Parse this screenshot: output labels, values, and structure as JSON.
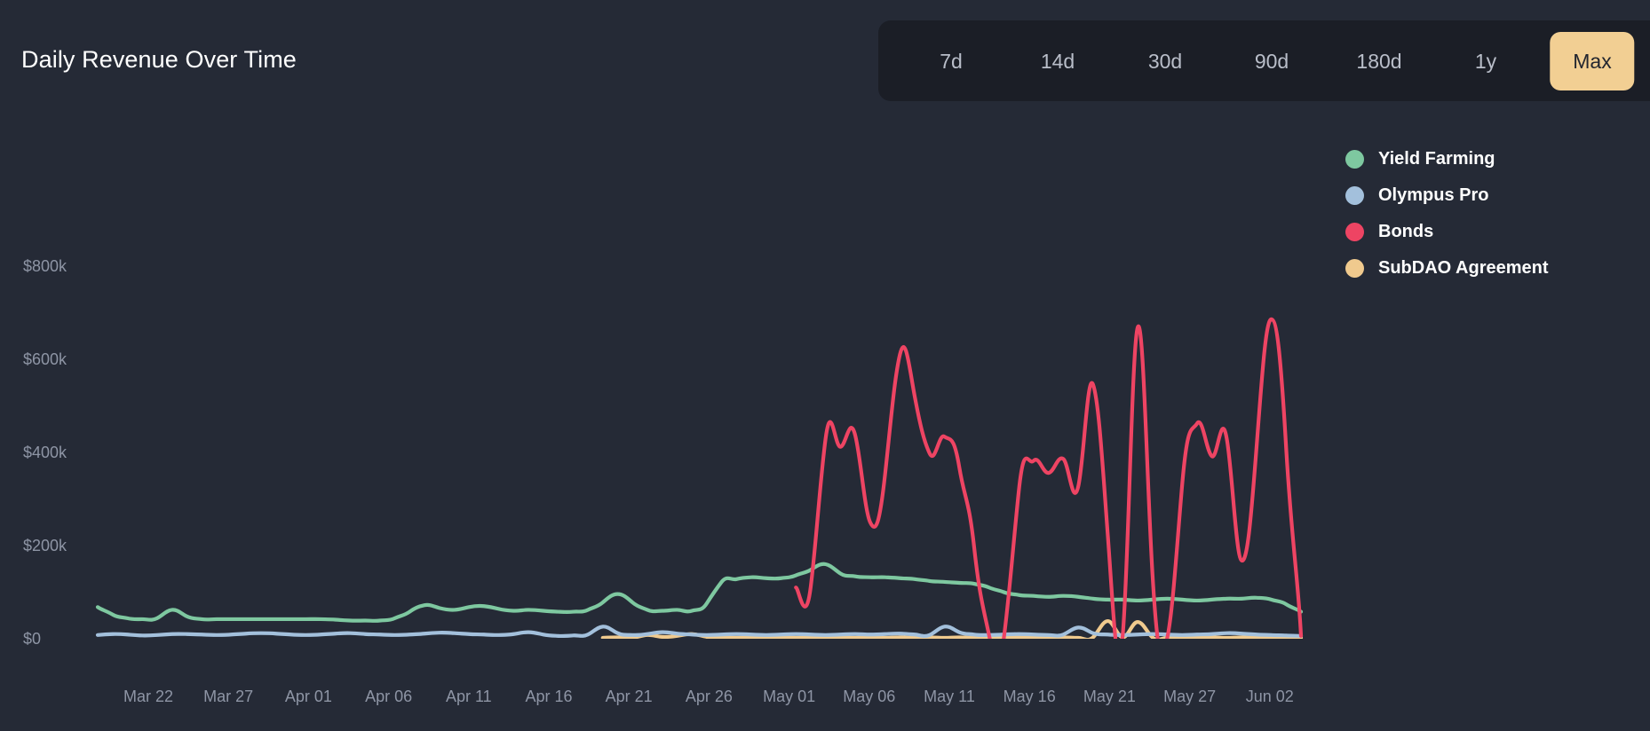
{
  "header": {
    "title": "Daily Revenue Over Time"
  },
  "range_selector": {
    "options": [
      {
        "label": "7d",
        "active": false
      },
      {
        "label": "14d",
        "active": false
      },
      {
        "label": "30d",
        "active": false
      },
      {
        "label": "90d",
        "active": false
      },
      {
        "label": "180d",
        "active": false
      },
      {
        "label": "1y",
        "active": false
      },
      {
        "label": "Max",
        "active": true
      }
    ],
    "selected": "Max"
  },
  "colors": {
    "background": "#252a36",
    "panel": "#1b1e26",
    "accent": "#f2cf93",
    "yield_farming": "#7ec8a0",
    "olympus_pro": "#a3c0dc",
    "bonds": "#ee4463",
    "subdao_agreement": "#f0ca8e",
    "axis_text": "#8e95a5",
    "title_text": "#ffffff"
  },
  "chart_data": {
    "type": "line",
    "title": "Daily Revenue Over Time",
    "xlabel": "",
    "ylabel": "",
    "ylim": [
      0,
      880000
    ],
    "grid": false,
    "legend_position": "right",
    "y_ticks": [
      {
        "label": "$0",
        "value": 0
      },
      {
        "label": "$200k",
        "value": 200000
      },
      {
        "label": "$400k",
        "value": 400000
      },
      {
        "label": "$600k",
        "value": 600000
      },
      {
        "label": "$800k",
        "value": 800000
      }
    ],
    "x_ticks": [
      "Mar 22",
      "Mar 27",
      "Apr 01",
      "Apr 06",
      "Apr 11",
      "Apr 16",
      "Apr 21",
      "Apr 26",
      "May 01",
      "May 06",
      "May 11",
      "May 16",
      "May 21",
      "May 27",
      "Jun 02"
    ],
    "x_start": "Mar 21",
    "x_end": "Jun 04",
    "series": [
      {
        "name": "Yield Farming",
        "color": "#7ec8a0",
        "values": [
          68000,
          52000,
          44000,
          42000,
          44000,
          62000,
          48000,
          42000,
          42000,
          42000,
          42000,
          42000,
          42000,
          42000,
          42000,
          42000,
          41000,
          39000,
          39000,
          39000,
          44000,
          58000,
          72000,
          66000,
          62000,
          68000,
          70000,
          64000,
          60000,
          62000,
          60000,
          58000,
          58000,
          62000,
          78000,
          96000,
          78000,
          62000,
          60000,
          62000,
          60000,
          76000,
          122000,
          128000,
          132000,
          130000,
          130000,
          136000,
          148000,
          160000,
          140000,
          134000,
          132000,
          132000,
          130000,
          128000,
          124000,
          122000,
          120000,
          118000,
          110000,
          100000,
          94000,
          92000,
          90000,
          92000,
          90000,
          86000,
          84000,
          84000,
          82000,
          84000,
          86000,
          84000,
          82000,
          84000,
          86000,
          86000,
          88000,
          84000,
          74000,
          58000
        ]
      },
      {
        "name": "Olympus Pro",
        "color": "#a3c0dc",
        "values": [
          8000,
          10000,
          9000,
          7000,
          8000,
          10000,
          10000,
          9000,
          8000,
          9000,
          11000,
          12000,
          11000,
          9000,
          8000,
          9000,
          11000,
          12000,
          10000,
          9000,
          8000,
          9000,
          11000,
          13000,
          12000,
          10000,
          9000,
          8000,
          10000,
          14000,
          9000,
          6000,
          7000,
          9000,
          26000,
          12000,
          8000,
          10000,
          14000,
          11000,
          9000,
          8000,
          9000,
          10000,
          9000,
          8000,
          9000,
          10000,
          9000,
          8000,
          9000,
          10000,
          9000,
          10000,
          11000,
          9000,
          8000,
          26000,
          14000,
          9000,
          8000,
          9000,
          10000,
          9000,
          8000,
          9000,
          24000,
          12000,
          9000,
          8000,
          9000,
          10000,
          9000,
          8000,
          9000,
          10000,
          12000,
          11000,
          9000,
          8000,
          7000,
          6000
        ]
      },
      {
        "name": "Bonds",
        "color": "#ee4463",
        "values": [
          null,
          null,
          null,
          null,
          null,
          null,
          null,
          null,
          null,
          null,
          null,
          null,
          null,
          null,
          null,
          null,
          null,
          null,
          null,
          null,
          null,
          null,
          null,
          null,
          null,
          null,
          null,
          null,
          null,
          null,
          null,
          null,
          null,
          null,
          null,
          null,
          null,
          null,
          null,
          null,
          null,
          null,
          null,
          null,
          null,
          null,
          null,
          110000,
          112000,
          430000,
          412000,
          436000,
          250000,
          352000,
          610000,
          520000,
          398000,
          434000,
          368000,
          196000,
          8000,
          2000,
          316000,
          382000,
          356000,
          386000,
          326000,
          546000,
          220000,
          8000,
          668000,
          140000,
          2000,
          330000,
          462000,
          392000,
          430000,
          168000,
          408000,
          686000,
          410000,
          6000
        ]
      },
      {
        "name": "SubDAO Agreement",
        "color": "#f0ca8e",
        "values": [
          null,
          null,
          null,
          null,
          null,
          null,
          null,
          null,
          null,
          null,
          null,
          null,
          null,
          null,
          null,
          null,
          null,
          null,
          null,
          null,
          null,
          null,
          null,
          null,
          null,
          null,
          null,
          null,
          null,
          null,
          null,
          null,
          null,
          null,
          2000,
          3000,
          2000,
          8000,
          4000,
          6000,
          10000,
          4000,
          3000,
          2000,
          3000,
          2000,
          3000,
          2000,
          3000,
          4000,
          3000,
          2000,
          3000,
          2000,
          3000,
          2000,
          3000,
          2000,
          3000,
          2000,
          3000,
          2000,
          4000,
          3000,
          2000,
          3000,
          2000,
          3000,
          38000,
          3000,
          36000,
          3000,
          2000,
          3000,
          2000,
          3000,
          2000,
          3000,
          2000,
          3000,
          2000,
          2000
        ]
      }
    ]
  }
}
